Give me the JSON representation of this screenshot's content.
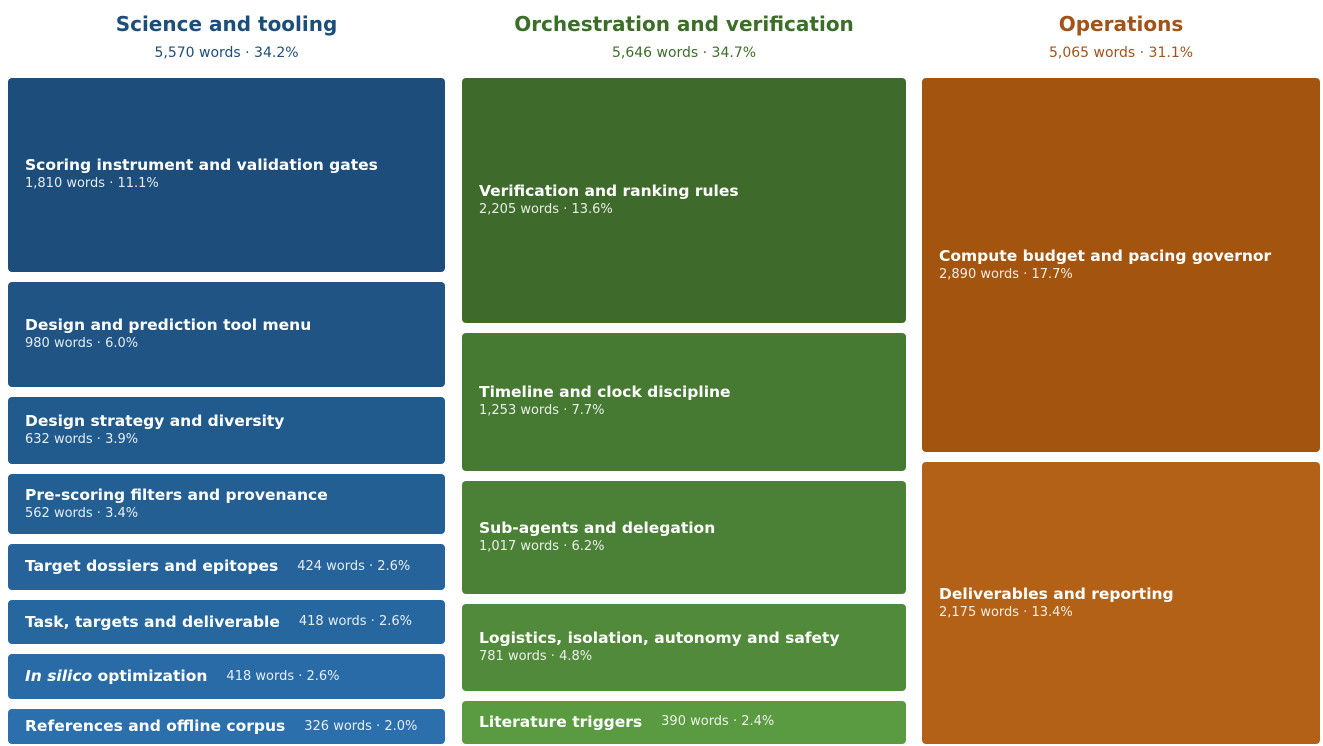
{
  "chart_data": {
    "type": "treemap",
    "unit": "words",
    "groups": [
      {
        "name": "Science and tooling",
        "summary": "5,570 words · 34.2%",
        "words": 5570,
        "percent": 34.2,
        "color": "#1d4e7a",
        "items": [
          {
            "label": "Scoring instrument and validation gates",
            "stats": "1,810 words · 11.1%",
            "words": 1810,
            "percent": 11.1,
            "color": "#1c4d7b",
            "inline": false
          },
          {
            "label": "Design and prediction tool menu",
            "stats": "980 words · 6.0%",
            "words": 980,
            "percent": 6.0,
            "color": "#1f5484",
            "inline": false
          },
          {
            "label": "Design strategy and diversity",
            "stats": "632 words · 3.9%",
            "words": 632,
            "percent": 3.9,
            "color": "#215a8c",
            "inline": false
          },
          {
            "label": "Pre-scoring filters and provenance",
            "stats": "562 words · 3.4%",
            "words": 562,
            "percent": 3.4,
            "color": "#235f93",
            "inline": false
          },
          {
            "label": "Target dossiers and epitopes",
            "stats": "424 words · 2.6%",
            "words": 424,
            "percent": 2.6,
            "color": "#25639a",
            "inline": true
          },
          {
            "label": "Task, targets and deliverable",
            "stats": "418 words · 2.6%",
            "words": 418,
            "percent": 2.6,
            "color": "#2767a0",
            "inline": true
          },
          {
            "label_italic": "In silico",
            "label": " optimization",
            "stats": "418 words · 2.6%",
            "words": 418,
            "percent": 2.6,
            "color": "#296ba6",
            "inline": true
          },
          {
            "label": "References and offline corpus",
            "stats": "326 words · 2.0%",
            "words": 326,
            "percent": 2.0,
            "color": "#2b6fac",
            "inline": true
          }
        ]
      },
      {
        "name": "Orchestration and verification",
        "summary": "5,646 words · 34.7%",
        "words": 5646,
        "percent": 34.7,
        "color": "#3c6e2a",
        "items": [
          {
            "label": "Verification and ranking rules",
            "stats": "2,205 words · 13.6%",
            "words": 2205,
            "percent": 13.6,
            "color": "#3e6b2b",
            "inline": false
          },
          {
            "label": "Timeline and clock discipline",
            "stats": "1,253 words · 7.7%",
            "words": 1253,
            "percent": 7.7,
            "color": "#467a33",
            "inline": false
          },
          {
            "label": "Sub-agents and delegation",
            "stats": "1,017 words · 6.2%",
            "words": 1017,
            "percent": 6.2,
            "color": "#4b8136",
            "inline": false
          },
          {
            "label": "Logistics, isolation, autonomy and safety",
            "stats": "781 words · 4.8%",
            "words": 781,
            "percent": 4.8,
            "color": "#518a3a",
            "inline": false
          },
          {
            "label": "Literature triggers",
            "stats": "390 words · 2.4%",
            "words": 390,
            "percent": 2.4,
            "color": "#5a9a41",
            "inline": true
          }
        ]
      },
      {
        "name": "Operations",
        "summary": "5,065 words · 31.1%",
        "words": 5065,
        "percent": 31.1,
        "color": "#a0541a",
        "items": [
          {
            "label": "Compute budget and pacing governor",
            "stats": "2,890 words · 17.7%",
            "words": 2890,
            "percent": 17.7,
            "color": "#a3550f",
            "inline": false
          },
          {
            "label": "Deliverables and reporting",
            "stats": "2,175 words · 13.4%",
            "words": 2175,
            "percent": 13.4,
            "color": "#b36116",
            "inline": false
          }
        ]
      }
    ]
  }
}
